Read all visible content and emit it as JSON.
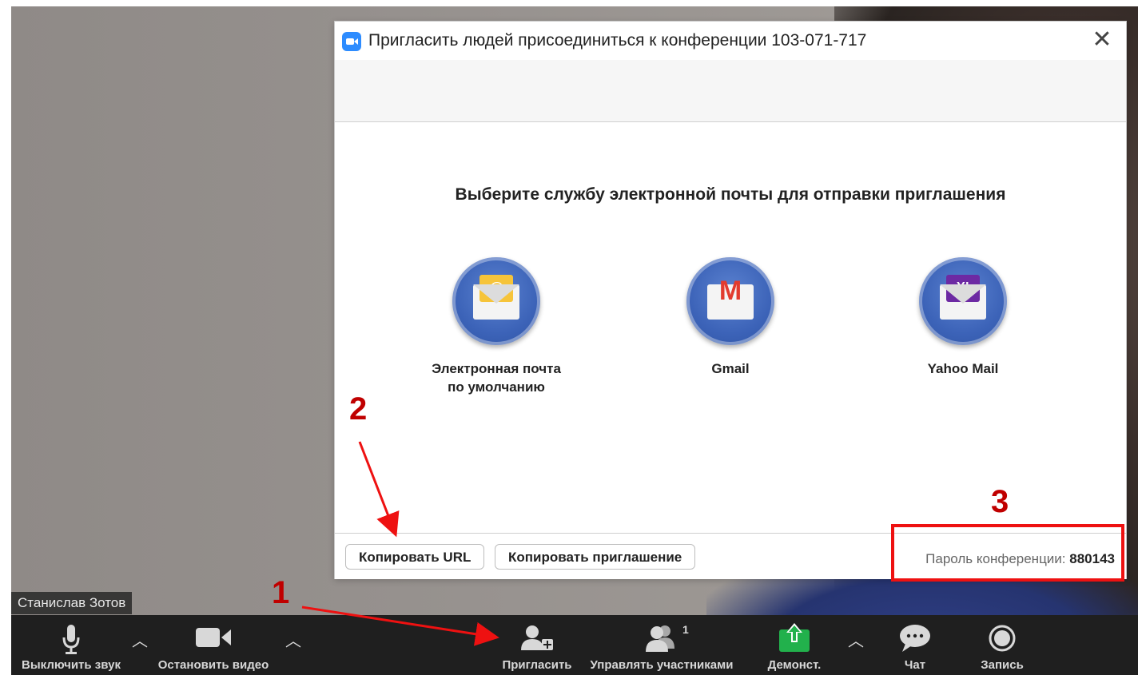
{
  "participant_name": "Станислав Зотов",
  "dialog": {
    "title": "Пригласить людей присоединиться к конференции 103-071-717",
    "heading": "Выберите службу электронной почты для отправки приглашения",
    "services": [
      {
        "label_line1": "Электронная почта",
        "label_line2": "по умолчанию",
        "icon": "at-sign"
      },
      {
        "label_line1": "Gmail",
        "label_line2": "",
        "icon": "M"
      },
      {
        "label_line1": "Yahoo Mail",
        "label_line2": "",
        "icon": "Y!"
      }
    ],
    "copy_url_label": "Копировать URL",
    "copy_invite_label": "Копировать приглашение",
    "password_label": "Пароль конференции:",
    "password_value": "880143"
  },
  "toolbar": {
    "mute_label": "Выключить звук",
    "video_label": "Остановить видео",
    "invite_label": "Пригласить",
    "participants_label": "Управлять участниками",
    "participants_count": "1",
    "share_label": "Демонст.",
    "chat_label": "Чат",
    "record_label": "Запись"
  },
  "annotations": {
    "one": "1",
    "two": "2",
    "three": "3"
  },
  "colors": {
    "annotation": "#c00000",
    "box": "#ee1111",
    "share_green": "#22b14c",
    "zoom_blue": "#2d8cff"
  }
}
